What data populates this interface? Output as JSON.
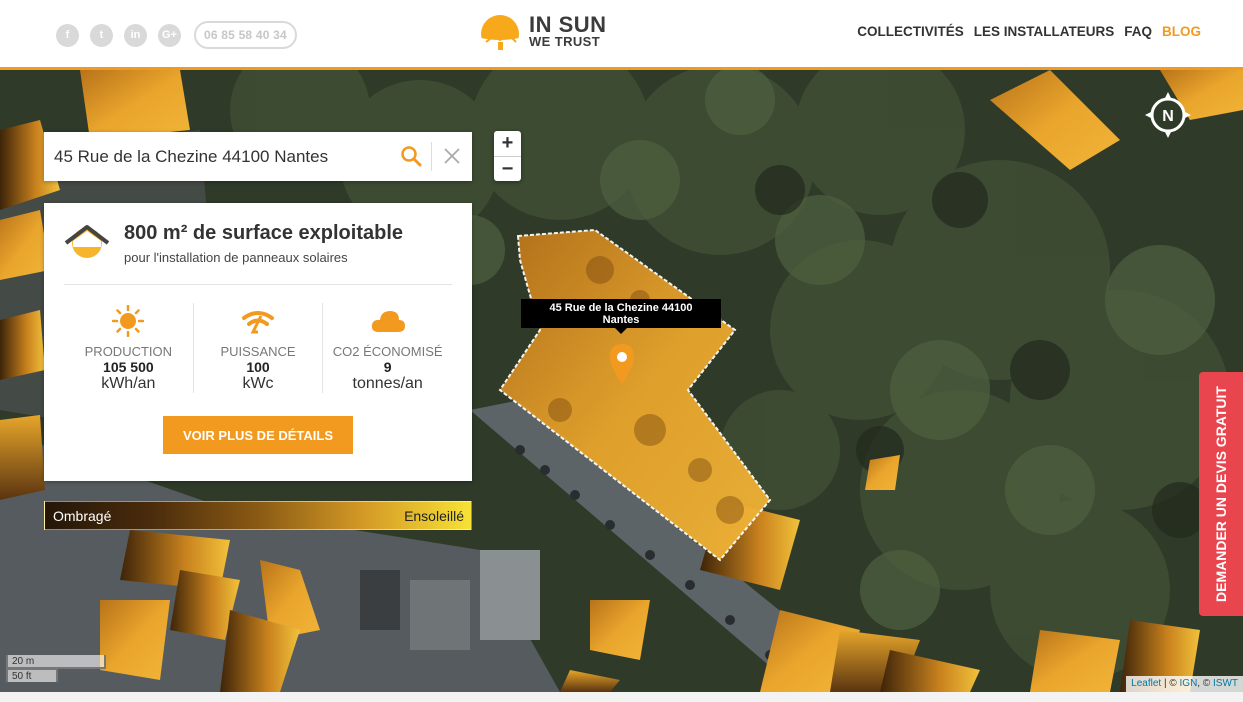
{
  "header": {
    "social": [
      {
        "icon": "facebook-icon",
        "glyph": "f"
      },
      {
        "icon": "twitter-icon",
        "glyph": "t"
      },
      {
        "icon": "linkedin-icon",
        "glyph": "in"
      },
      {
        "icon": "google-plus-icon",
        "glyph": "G+"
      }
    ],
    "phone": "06 85 58 40 34",
    "logo_line1": "IN SUN",
    "logo_line2": "WE TRUST",
    "nav": [
      "COLLECTIVITÉS",
      "LES INSTALLATEURS",
      "FAQ",
      "BLOG"
    ],
    "active_nav": "BLOG",
    "accent_color": "#f29a1f"
  },
  "search": {
    "value": "45 Rue de la Chezine 44100 Nantes"
  },
  "zoom": {
    "in": "+",
    "out": "−"
  },
  "info": {
    "title": "800 m² de surface exploitable",
    "subtitle": "pour l'installation de panneaux solaires",
    "stats": [
      {
        "icon": "sun-icon",
        "label": "PRODUCTION",
        "value": "105 500",
        "unit": "kWh/an"
      },
      {
        "icon": "signal-icon",
        "label": "PUISSANCE",
        "value": "100",
        "unit": "kWc"
      },
      {
        "icon": "cloud-icon",
        "label": "CO2 ÉCONOMISÉ",
        "value": "9",
        "unit": "tonnes/an"
      }
    ],
    "button": "VOIR PLUS DE DÉTAILS"
  },
  "legend": {
    "left": "Ombragé",
    "right": "Ensoleillé"
  },
  "tooltip": {
    "line1": "45 Rue de la Chezine 44100",
    "line2": "Nantes"
  },
  "compass": {
    "label": "N"
  },
  "cta": "DEMANDER UN DEVIS GRATUIT",
  "scale": {
    "metric": "20 m",
    "imperial": "50 ft"
  },
  "attribution": {
    "leaflet": "Leaflet",
    "sep1": " | © ",
    "ign": "IGN",
    "sep2": ", © ",
    "iswt": "ISWT"
  }
}
